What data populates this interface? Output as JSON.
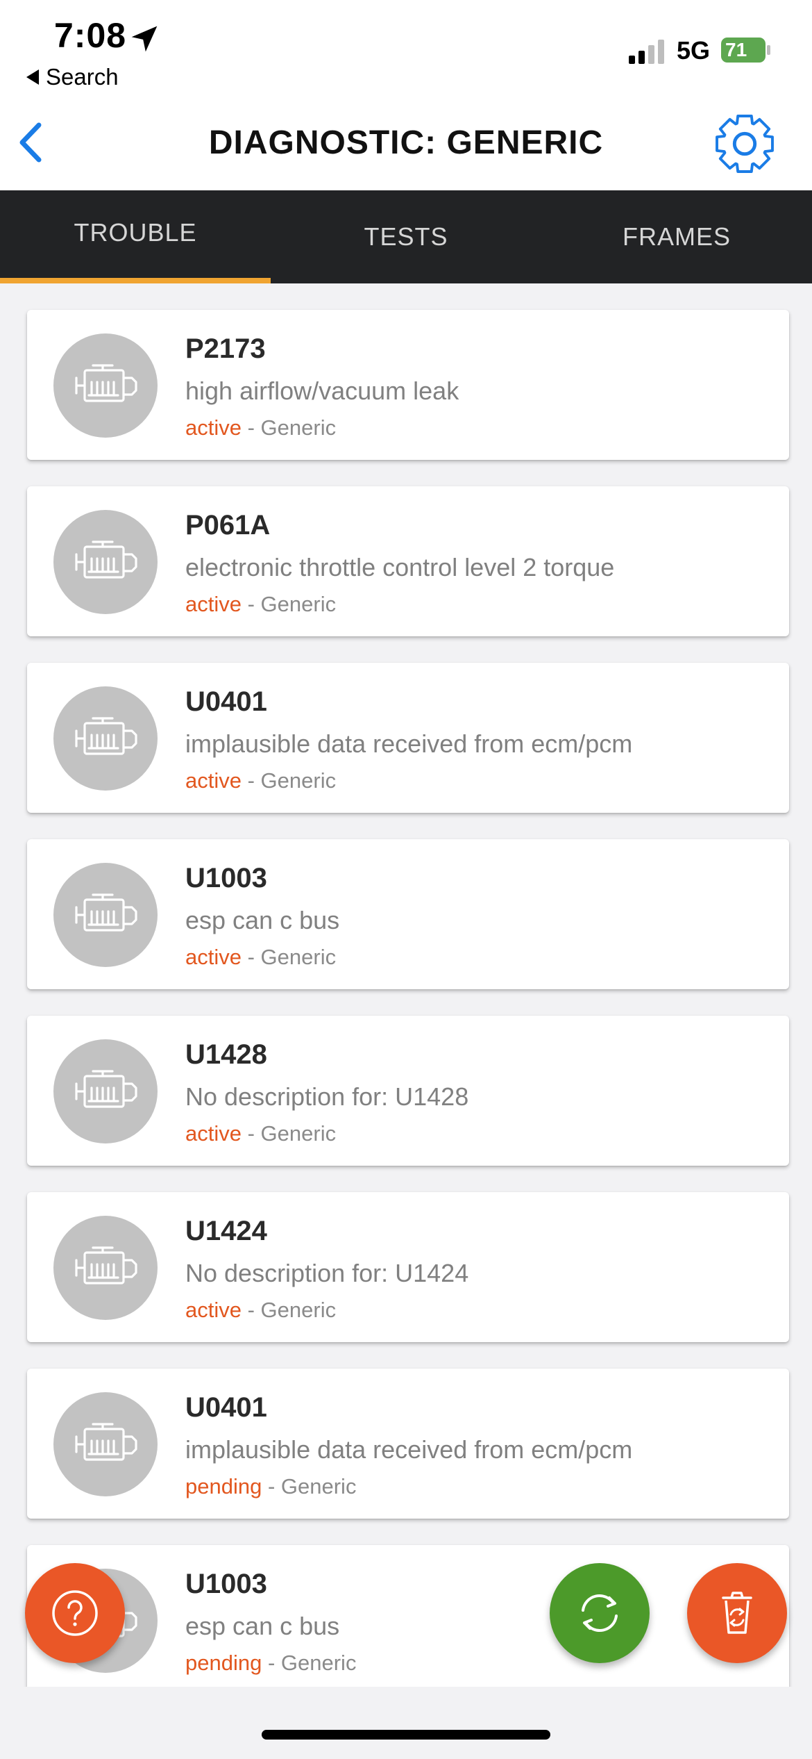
{
  "status_bar": {
    "time": "7:08",
    "back_label": "Search",
    "network": "5G",
    "battery": "71"
  },
  "navbar": {
    "title": "DIAGNOSTIC: GENERIC"
  },
  "tabs": [
    {
      "label": "TROUBLE",
      "active": true
    },
    {
      "label": "TESTS",
      "active": false
    },
    {
      "label": "FRAMES",
      "active": false
    }
  ],
  "codes": [
    {
      "code": "P2173",
      "description": "high airflow/vacuum leak",
      "status": "active",
      "source": " - Generic"
    },
    {
      "code": "P061A",
      "description": "electronic throttle control level 2 torque",
      "status": "active",
      "source": " - Generic"
    },
    {
      "code": "U0401",
      "description": "implausible data received from ecm/pcm",
      "status": "active",
      "source": " - Generic"
    },
    {
      "code": "U1003",
      "description": "esp can c bus",
      "status": "active",
      "source": " - Generic"
    },
    {
      "code": "U1428",
      "description": "No description for: U1428",
      "status": "active",
      "source": " - Generic"
    },
    {
      "code": "U1424",
      "description": "No description for: U1424",
      "status": "active",
      "source": " - Generic"
    },
    {
      "code": "U0401",
      "description": "implausible data received from ecm/pcm",
      "status": "pending",
      "source": " - Generic"
    },
    {
      "code": "U1003",
      "description": "esp can c bus",
      "status": "pending",
      "source": " - Generic"
    }
  ],
  "colors": {
    "accent": "#1a7ce6",
    "tab_indicator": "#f0a431",
    "status": "#e2571f",
    "fab_orange": "#ea5727",
    "fab_green": "#4c9a2a"
  },
  "icons": {
    "help": "question-icon",
    "refresh": "refresh-icon",
    "clear": "trash-refresh-icon",
    "settings": "gear-icon",
    "code_item": "engine-icon"
  }
}
